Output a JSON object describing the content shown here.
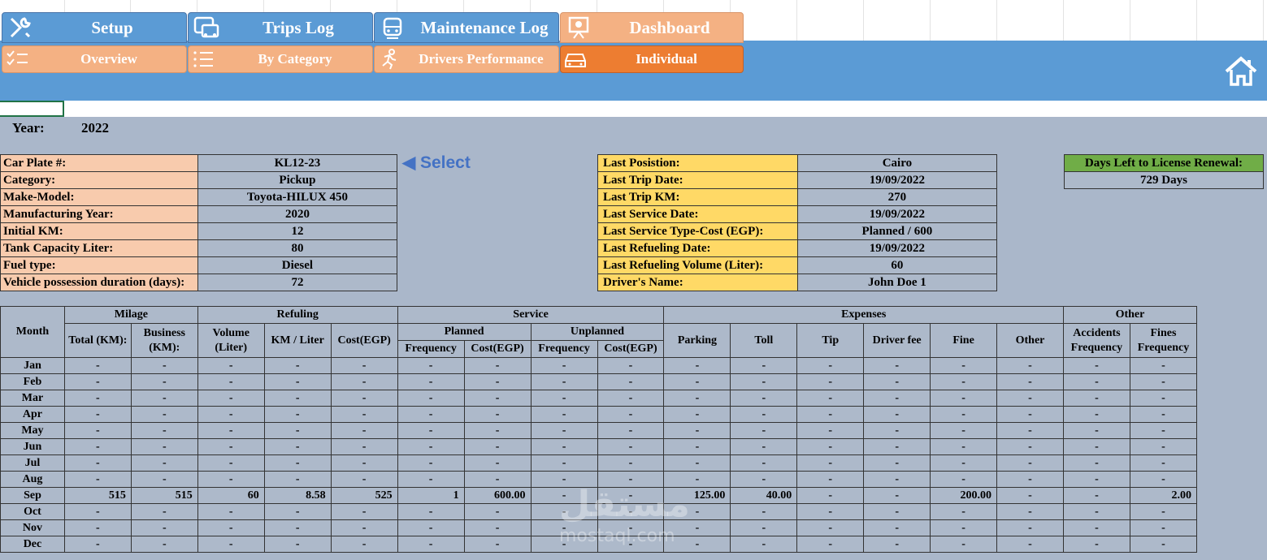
{
  "nav": {
    "tabs": [
      {
        "label": "Setup",
        "icon": "tools-icon"
      },
      {
        "label": "Trips Log",
        "icon": "bus-icon"
      },
      {
        "label": "Maintenance Log",
        "icon": "car-front-icon"
      },
      {
        "label": "Dashboard",
        "icon": "presentation-icon"
      }
    ],
    "subtabs": [
      {
        "label": "Overview",
        "icon": "checklist-icon"
      },
      {
        "label": "By Category",
        "icon": "list-icon"
      },
      {
        "label": "Drivers Performance",
        "icon": "runner-icon"
      },
      {
        "label": "Individual",
        "icon": "car-icon",
        "active": true
      }
    ]
  },
  "year": {
    "label": "Year:",
    "value": "2022"
  },
  "vehicle_info": [
    {
      "key": "Car Plate #:",
      "value": "KL12-23"
    },
    {
      "key": "Category:",
      "value": "Pickup"
    },
    {
      "key": "Make-Model:",
      "value": "Toyota-HILUX 450"
    },
    {
      "key": "Manufacturing Year:",
      "value": "2020"
    },
    {
      "key": " Initial KM:",
      "value": "12"
    },
    {
      "key": " Tank Capacity Liter:",
      "value": "80"
    },
    {
      "key": " Fuel type:",
      "value": "Diesel"
    },
    {
      "key": " Vehicle possession duration (days):",
      "value": "72"
    }
  ],
  "select_label": "Select",
  "last_info": [
    {
      "key": "Last Posistion:",
      "value": "Cairo"
    },
    {
      "key": "Last Trip Date:",
      "value": "19/09/2022"
    },
    {
      "key": "Last Trip KM:",
      "value": "270"
    },
    {
      "key": "Last Service Date:",
      "value": "19/09/2022"
    },
    {
      "key": "Last Service Type-Cost (EGP):",
      "value": "Planned / 600"
    },
    {
      "key": "Last Refueling Date:",
      "value": "19/09/2022"
    },
    {
      "key": "Last Refueling Volume (Liter):",
      "value": "60"
    },
    {
      "key": "Driver's Name:",
      "value": "John Doe 1"
    }
  ],
  "license": {
    "label": "Days Left to License Renewal:",
    "value": "729 Days"
  },
  "table": {
    "month_header": "Month",
    "groups": {
      "milage": "Milage",
      "refueling": "Refuling",
      "service": "Service",
      "expenses": "Expenses",
      "other": "Other",
      "planned": "Planned",
      "unplanned": "Unplanned"
    },
    "cols": {
      "total": "Total (KM):",
      "business": "Business (KM):",
      "volume": "Volume (Liter)",
      "kmliter": "KM / Liter",
      "cost": "Cost(EGP)",
      "p_freq": "Frequency",
      "p_cost": "Cost(EGP)",
      "u_freq": "Frequency",
      "u_cost": "Cost(EGP)",
      "parking": "Parking",
      "toll": "Toll",
      "tip": "Tip",
      "driver_fee": "Driver fee",
      "fine": "Fine",
      "exp_other": "Other",
      "accidents": "Accidents Frequency",
      "fines": "Fines Frequency"
    },
    "rows": [
      {
        "month": "Jan",
        "v": [
          "-",
          "-",
          "-",
          "-",
          "-",
          "-",
          "-",
          "-",
          "-",
          "-",
          "-",
          "-",
          "-",
          "-",
          "-",
          "-",
          "-"
        ]
      },
      {
        "month": "Feb",
        "v": [
          "-",
          "-",
          "-",
          "-",
          "-",
          "-",
          "-",
          "-",
          "-",
          "-",
          "-",
          "-",
          "-",
          "-",
          "-",
          "-",
          "-"
        ]
      },
      {
        "month": "Mar",
        "v": [
          "-",
          "-",
          "-",
          "-",
          "-",
          "-",
          "-",
          "-",
          "-",
          "-",
          "-",
          "-",
          "-",
          "-",
          "-",
          "-",
          "-"
        ]
      },
      {
        "month": "Apr",
        "v": [
          "-",
          "-",
          "-",
          "-",
          "-",
          "-",
          "-",
          "-",
          "-",
          "-",
          "-",
          "-",
          "-",
          "-",
          "-",
          "-",
          "-"
        ]
      },
      {
        "month": "May",
        "v": [
          "-",
          "-",
          "-",
          "-",
          "-",
          "-",
          "-",
          "-",
          "-",
          "-",
          "-",
          "-",
          "-",
          "-",
          "-",
          "-",
          "-"
        ]
      },
      {
        "month": "Jun",
        "v": [
          "-",
          "-",
          "-",
          "-",
          "-",
          "-",
          "-",
          "-",
          "-",
          "-",
          "-",
          "-",
          "-",
          "-",
          "-",
          "-",
          "-"
        ]
      },
      {
        "month": "Jul",
        "v": [
          "-",
          "-",
          "-",
          "-",
          "-",
          "-",
          "-",
          "-",
          "-",
          "-",
          "-",
          "-",
          "-",
          "-",
          "-",
          "-",
          "-"
        ]
      },
      {
        "month": "Aug",
        "v": [
          "-",
          "-",
          "-",
          "-",
          "-",
          "-",
          "-",
          "-",
          "-",
          "-",
          "-",
          "-",
          "-",
          "-",
          "-",
          "-",
          "-"
        ]
      },
      {
        "month": "Sep",
        "v": [
          "515",
          "515",
          "60",
          "8.58",
          "525",
          "1",
          "600.00",
          "-",
          "-",
          "125.00",
          "40.00",
          "-",
          "-",
          "200.00",
          "-",
          "-",
          "2.00"
        ]
      },
      {
        "month": "Oct",
        "v": [
          "-",
          "-",
          "-",
          "-",
          "-",
          "-",
          "-",
          "-",
          "-",
          "-",
          "-",
          "-",
          "-",
          "-",
          "-",
          "-",
          "-"
        ]
      },
      {
        "month": "Nov",
        "v": [
          "-",
          "-",
          "-",
          "-",
          "-",
          "-",
          "-",
          "-",
          "-",
          "-",
          "-",
          "-",
          "-",
          "-",
          "-",
          "-",
          "-"
        ]
      },
      {
        "month": "Dec",
        "v": [
          "-",
          "-",
          "-",
          "-",
          "-",
          "-",
          "-",
          "-",
          "-",
          "-",
          "-",
          "-",
          "-",
          "-",
          "-",
          "-",
          "-"
        ]
      }
    ]
  },
  "watermark": {
    "line1": "مستقل",
    "line2": "mostaql.com"
  },
  "colors": {
    "band": "#5b9bd5",
    "peach": "#f4b183",
    "orange": "#ed7d31",
    "panel": "#adb9ca",
    "salmon": "#f8cbad",
    "yellow": "#ffd966",
    "green": "#70ad47",
    "select": "#4472c4"
  }
}
